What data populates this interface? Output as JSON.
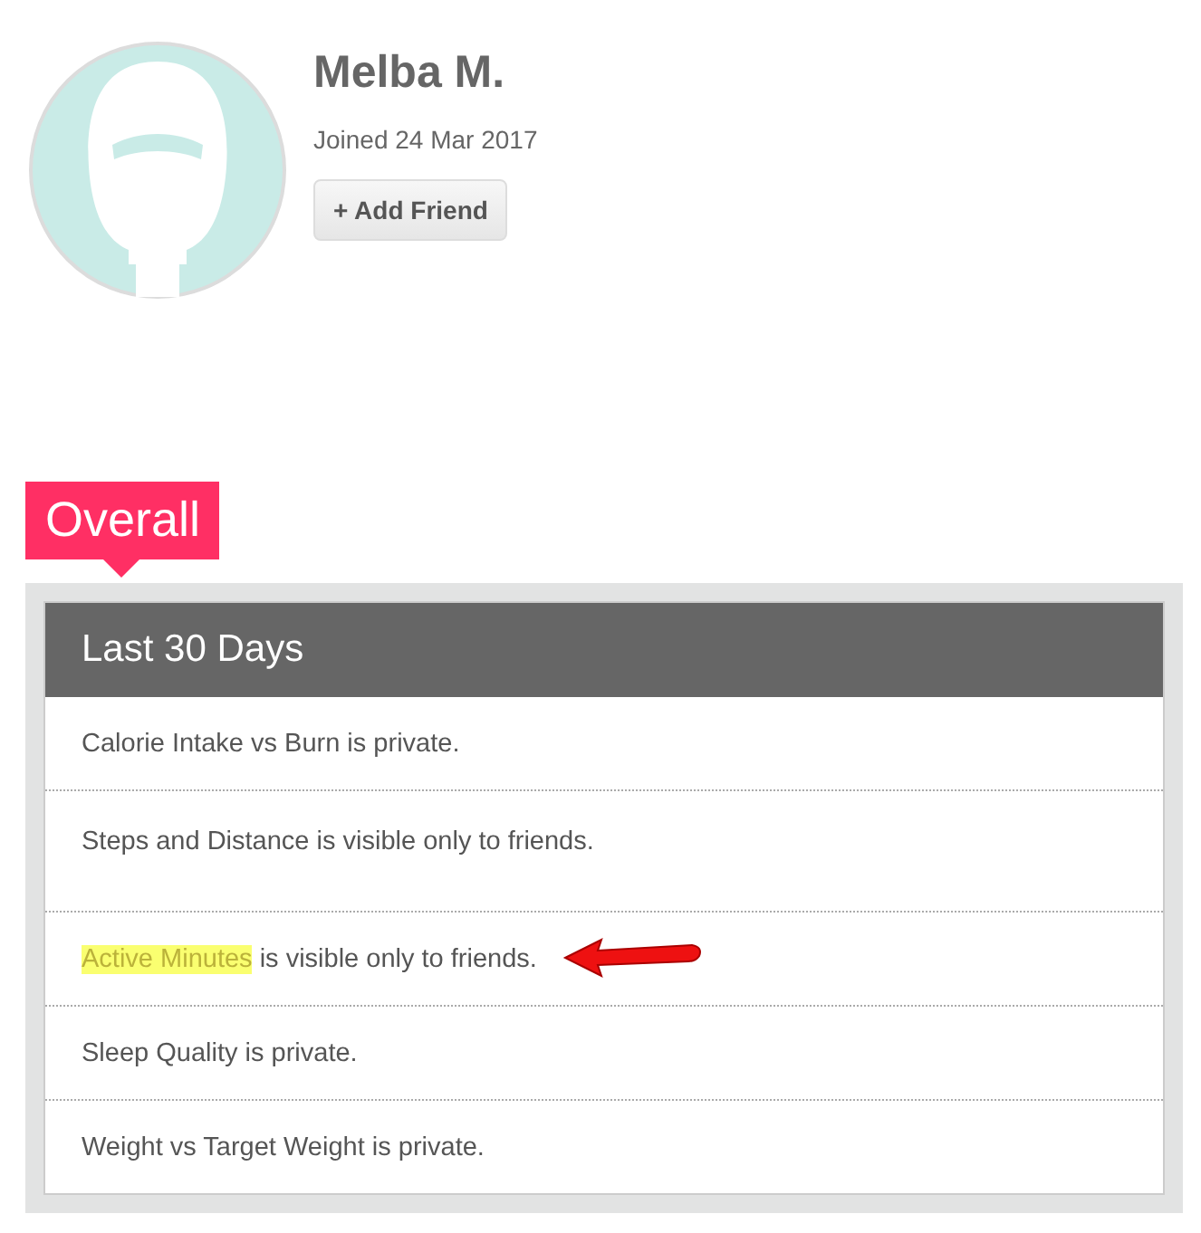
{
  "profile": {
    "name": "Melba M.",
    "joined": "Joined 24 Mar 2017",
    "button": {
      "icon": "+",
      "label": "Add Friend"
    }
  },
  "tag": "Overall",
  "panel": {
    "title": "Last 30 Days",
    "rows": [
      {
        "text": "Calorie Intake vs Burn is private."
      },
      {
        "text": "Steps and Distance is visible only to friends.",
        "tall": true
      },
      {
        "highlight": "Active Minutes",
        "text": "is visible only to friends.",
        "arrow": true
      },
      {
        "text": "Sleep Quality is private."
      },
      {
        "text": "Weight vs Target Weight is private."
      }
    ]
  }
}
